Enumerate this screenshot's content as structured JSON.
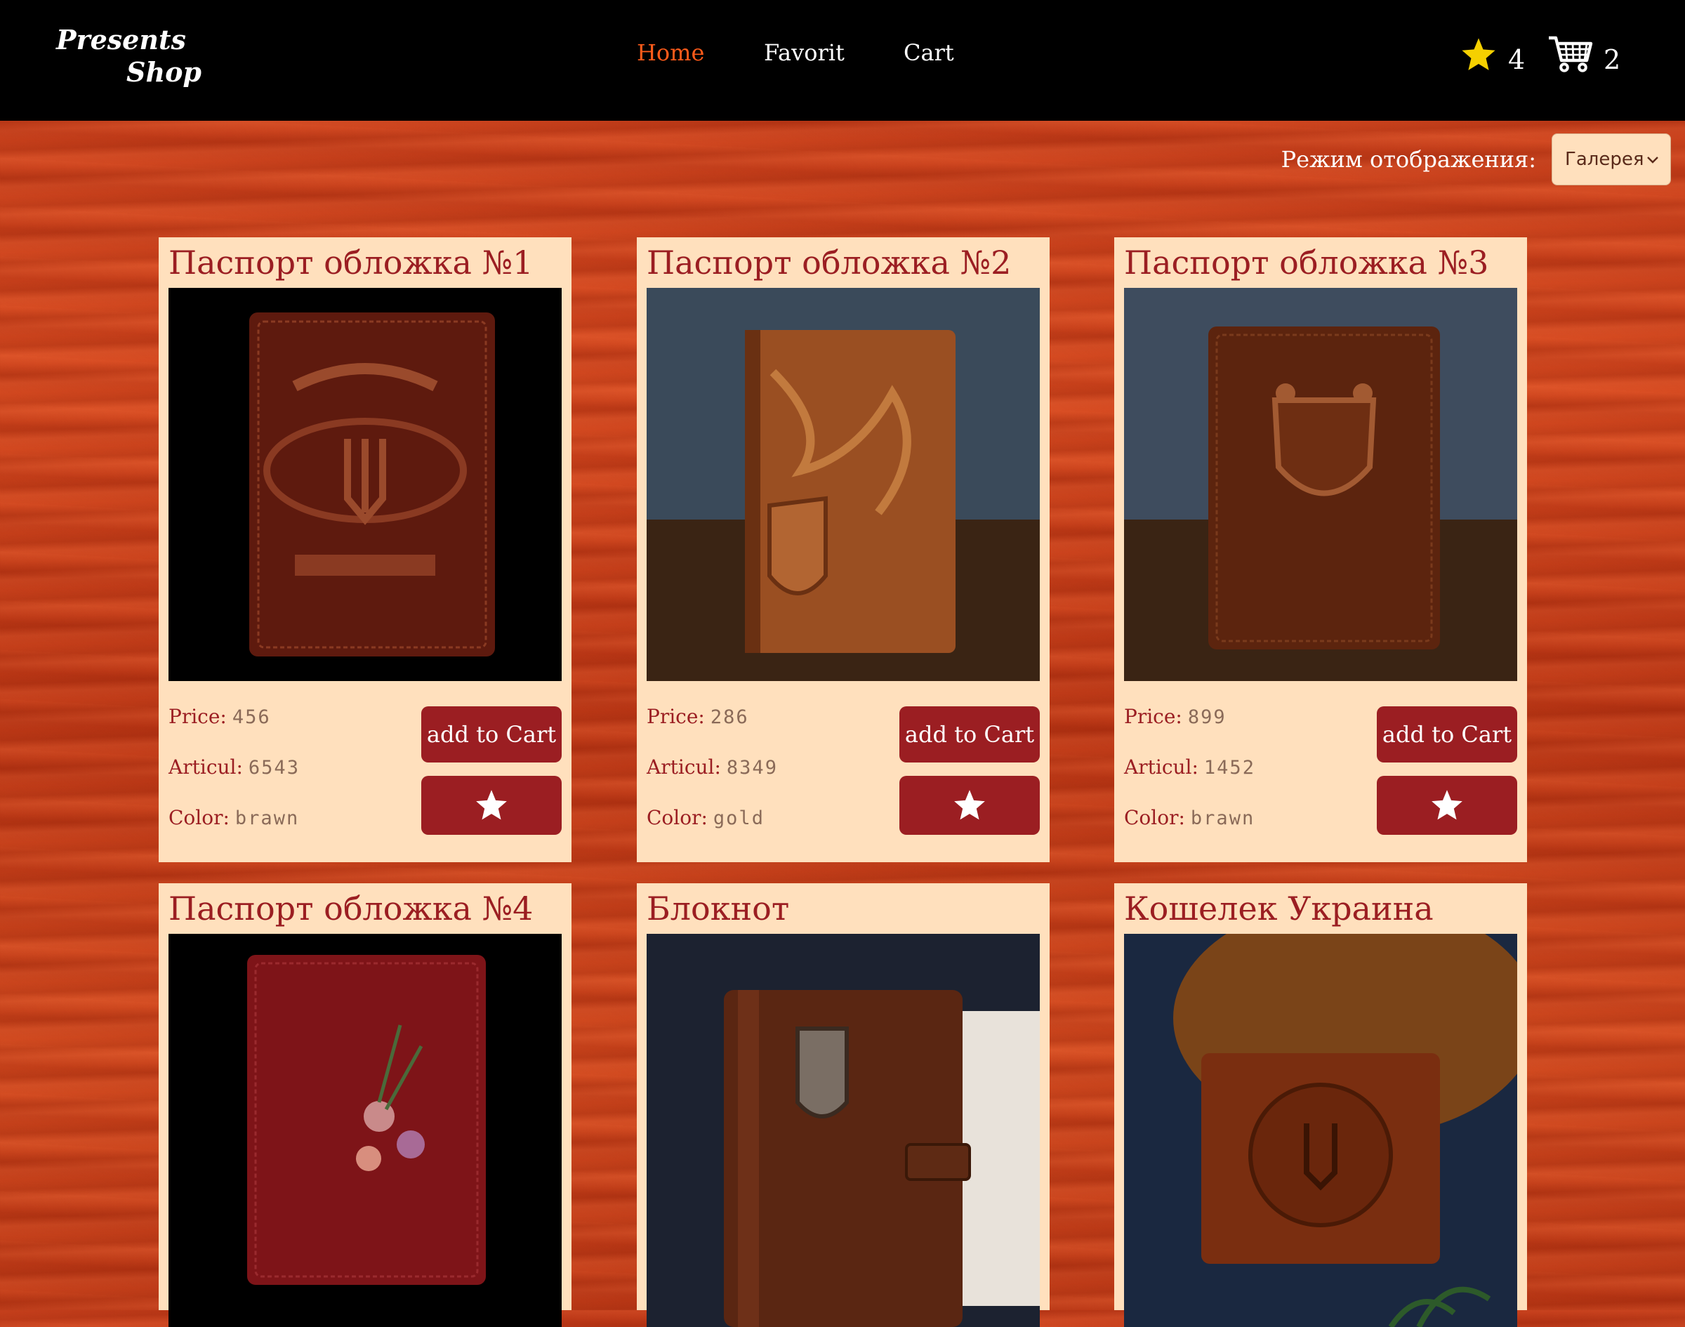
{
  "header": {
    "logo_line1": "Presents",
    "logo_line2": "Shop",
    "nav": [
      {
        "label": "Home",
        "active": true
      },
      {
        "label": "Favorit",
        "active": false
      },
      {
        "label": "Cart",
        "active": false
      }
    ],
    "favorites_count": "4",
    "cart_count": "2"
  },
  "view_mode": {
    "label": "Режим отображения:",
    "selected": "Галерея"
  },
  "labels": {
    "price": "Price:",
    "articul": "Articul:",
    "color": "Color:",
    "add_to_cart": "add to Cart"
  },
  "products": [
    {
      "title": "Паспорт обложка №1",
      "price": "456",
      "articul": "6543",
      "color": "brawn"
    },
    {
      "title": "Паспорт обложка №2",
      "price": "286",
      "articul": "8349",
      "color": "gold"
    },
    {
      "title": "Паспорт обложка №3",
      "price": "899",
      "articul": "1452",
      "color": "brawn"
    },
    {
      "title": "Паспорт обложка №4"
    },
    {
      "title": "Блокнот"
    },
    {
      "title": "Кошелек Украина"
    }
  ],
  "colors": {
    "accent": "#9b1e22",
    "card_bg": "#ffe0bd",
    "nav_active": "#ff5b1a",
    "star": "#f5d000"
  }
}
